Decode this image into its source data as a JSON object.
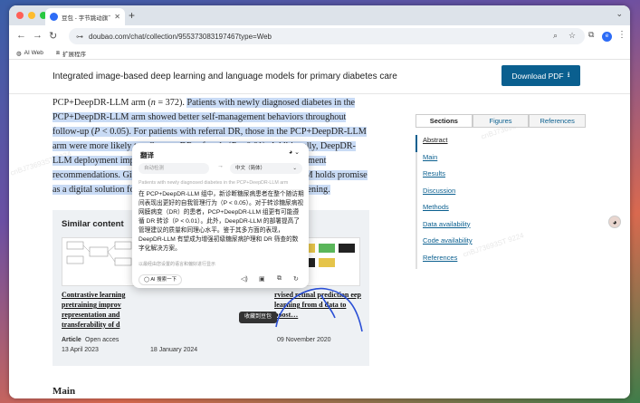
{
  "browser": {
    "tab_title": "豆包 - 字节跳动旗下 AI 智能助手",
    "url": "doubao.com/chat/collection/955373083197467type=Web",
    "profile_initial": "e",
    "bookmarks": [
      "AI Web",
      "扩展程序"
    ]
  },
  "page": {
    "title": "Integrated image-based deep learning and language models for primary diabetes care",
    "download_label": "Download PDF",
    "article_segments": [
      {
        "text": "PCP+DeepDR-LLM arm (",
        "hl": false
      },
      {
        "text": "n",
        "hl": false,
        "italic": true
      },
      {
        "text": " = 372). ",
        "hl": false
      },
      {
        "text": "Patients with newly diagnosed diabetes in the PCP+DeepDR-LLM arm showed better self-management behaviors throughout follow-up (",
        "hl": true
      },
      {
        "text": "P",
        "hl": true,
        "italic": true
      },
      {
        "text": " < 0.05). For patients with referral DR, those in the PCP+DeepDR-LLM arm were more likely to adhere to DR referrals (",
        "hl": true
      },
      {
        "text": "P",
        "hl": true,
        "italic": true
      },
      {
        "text": " < 0.01). Additionally, DeepDR-LLM deployment improved the quality and empathy level of management recommendations. Given its multifaceted performance, DeepDR-LLM holds promise as a digital solution for enhancing primary diabetes care and DR screening.",
        "hl": true
      }
    ],
    "sidebar_tabs": [
      "Sections",
      "Figures",
      "References"
    ],
    "sections": [
      "Abstract",
      "Main",
      "Results",
      "Discussion",
      "Methods",
      "Data availability",
      "Code availability",
      "References"
    ],
    "similar": {
      "title": "Similar content",
      "items": [
        {
          "title": "Contrastive learning pretraining improv representation and transferability of d",
          "type": "Article",
          "access": "Open acces",
          "date": "13 April 2023"
        },
        {
          "title": "",
          "type": "",
          "access": "",
          "date": "18 January 2024"
        },
        {
          "title": "rvised retinal prediction eep learning from d data to boost…",
          "type": "",
          "access": "",
          "date": "09 November 2020"
        }
      ]
    },
    "main_heading": "Main",
    "watermark": "cnBJ73693ST 9224"
  },
  "translate": {
    "title": "翻译",
    "from_lang": "自动检测",
    "to_lang": "中文（简体）",
    "source_preview": "Patients with newly diagnosed diabetes in the PCP+DeepDR-LLM arm",
    "translation": "在 PCP+DeepDR-LLM 组中，新诊断糖尿病患者在整个随访期间表现出更好的自我管理行为（P < 0.05）。对于转诊糖尿病视网膜病变（DR）的患者，PCP+DeepDR-LLM 组更有可能遵循 DR 转诊（P < 0.01）。此外，DeepDR-LLM 的部署提高了管理建议的质量和同理心水平。鉴于其多方面的表现，DeepDR-LLM 有望成为增强初级糖尿病护理和 DR 筛查的数字化解决方案。",
    "hint": "以最经由您设置的语言和偏好进行显示",
    "ai_search": "AI 搜索一下",
    "tooltip": "收藏到豆包"
  },
  "colors": {
    "accent": "#0a5f8f",
    "highlight": "#c9dbf5",
    "annotation": "#2a4fd6"
  }
}
